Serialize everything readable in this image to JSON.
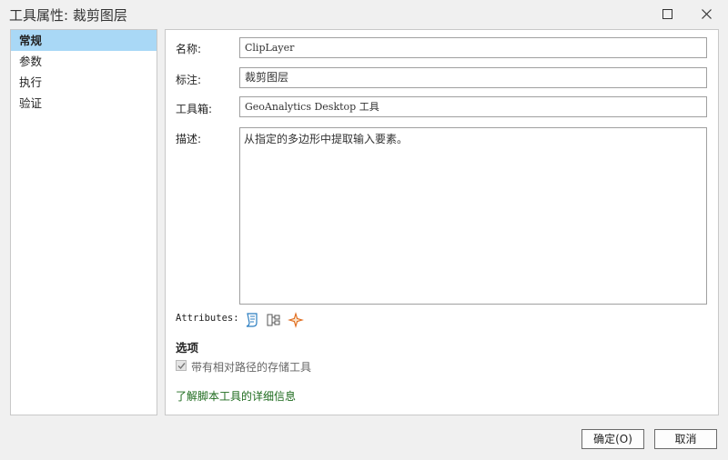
{
  "window": {
    "title": "工具属性: 裁剪图层"
  },
  "sidebar": {
    "items": [
      {
        "label": "常规",
        "selected": true
      },
      {
        "label": "参数"
      },
      {
        "label": "执行"
      },
      {
        "label": "验证"
      }
    ]
  },
  "general": {
    "name_label": "名称:",
    "name_value": "ClipLayer",
    "display_label": "标注:",
    "display_value": "裁剪图层",
    "toolbox_label": "工具箱:",
    "toolbox_value": "GeoAnalytics Desktop 工具",
    "description_label": "描述:",
    "description_value": "从指定的多边形中提取输入要素。",
    "attributes_label": "Attributes:",
    "attribute_icons": [
      "script-icon",
      "hierarchy-icon",
      "sparkle-icon"
    ],
    "options_title": "选项",
    "store_relative_paths_label": "带有相对路径的存储工具",
    "store_relative_paths_checked": true,
    "learn_more_link": "了解脚本工具的详细信息"
  },
  "buttons": {
    "ok": "确定(O)",
    "cancel": "取消"
  },
  "colors": {
    "selected_item": "#a9d8f6",
    "link": "#1e6b1e"
  }
}
